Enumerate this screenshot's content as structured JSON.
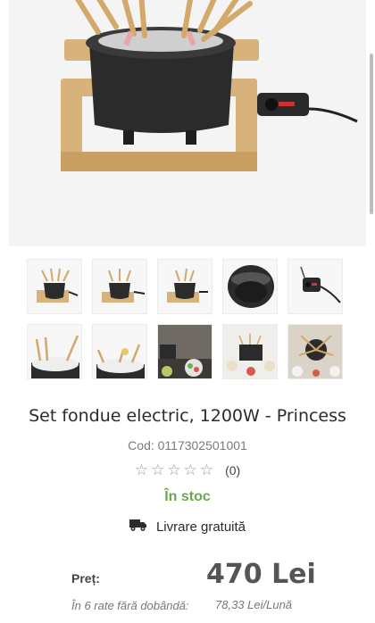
{
  "product": {
    "title": "Set fondue electric, 1200W - Princess",
    "code": "Cod: 0117302501001",
    "rating_count": "(0)",
    "rating_stars": 0,
    "stock": "În stoc",
    "delivery": "Livrare gratuită"
  },
  "price": {
    "label": "Preț:",
    "value": "470 Lei",
    "installment_label": "În 6 rate fără dobândă:",
    "installment_value": "78,33 Lei/Lună"
  },
  "thumbnails": [
    "fondue-set-thumb-1",
    "fondue-set-thumb-2",
    "fondue-set-thumb-3",
    "pot-interior-thumb",
    "thermostat-thumb",
    "fondue-forks-thumb-1",
    "fondue-forks-thumb-2",
    "serving-scene-thumb-1",
    "serving-scene-thumb-2",
    "serving-scene-thumb-3"
  ],
  "colors": {
    "stock": "#6aa84f",
    "star_empty": "#9a9a9a",
    "price": "#555555"
  }
}
